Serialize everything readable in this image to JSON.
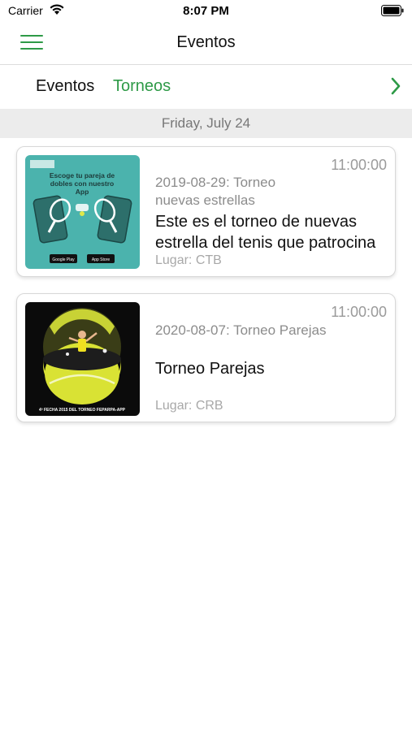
{
  "status_bar": {
    "carrier": "Carrier",
    "time": "8:07 PM"
  },
  "nav": {
    "title": "Eventos"
  },
  "tabs": [
    {
      "label": "Eventos",
      "active": false
    },
    {
      "label": "Torneos",
      "active": true
    }
  ],
  "date_header": "Friday, July 24",
  "events": [
    {
      "time": "11:00:00",
      "subtitle_line1": "2019-08-29: Torneo",
      "subtitle_line2": "nuevas estrellas",
      "title_line1": "Este es el torneo de nuevas",
      "title_line2": "estrella del tenis que patrocina",
      "location": "Lugar: CTB",
      "image_icon": "tennis-app-promo-image",
      "image_text": {
        "headline": "Escoge tu pareja de dobles con nuestro App",
        "store_1": "Google Play",
        "store_2": "App Store"
      }
    },
    {
      "time": "11:00:00",
      "subtitle": "2020-08-07: Torneo Parejas",
      "title": "Torneo Parejas",
      "location": "Lugar: CRB",
      "image_icon": "tennis-ball-player-image",
      "image_text": {
        "caption": "4ª FECHA 2015 DEL TORNEO FEPARPA-APP"
      }
    }
  ],
  "colors": {
    "accent": "#2e9a47",
    "date_header_bg": "#ececec",
    "promo_bg": "#4bb3ad",
    "ball_yellow": "#d9e234"
  }
}
